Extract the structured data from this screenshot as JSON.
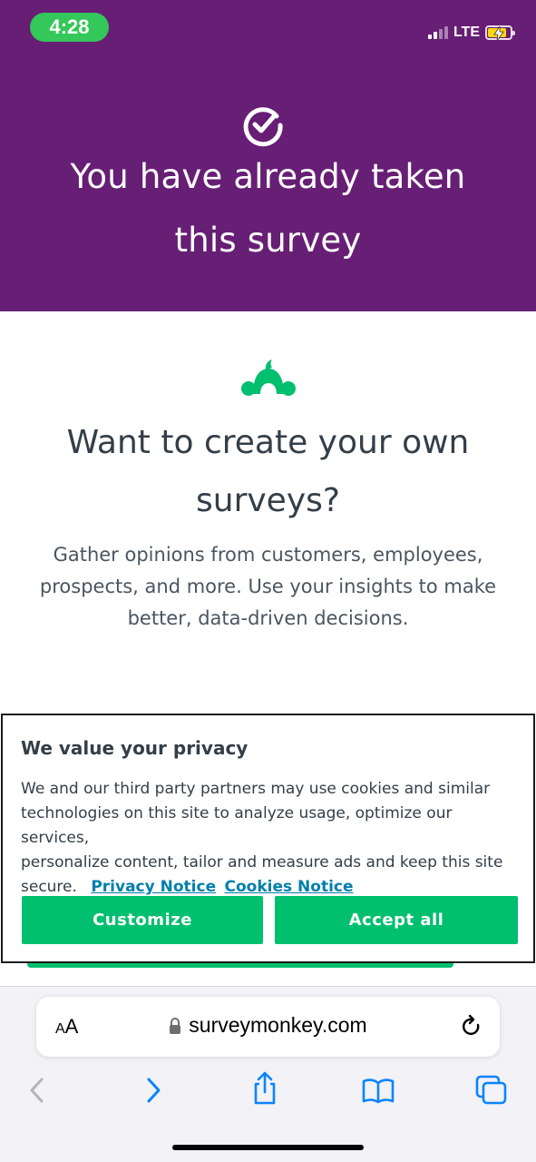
{
  "status_bar": {
    "time": "4:28",
    "network": "LTE"
  },
  "hero": {
    "title_line1": "You have already taken",
    "title_line2": "this survey"
  },
  "promo": {
    "title_line1": "Want to create your own",
    "title_line2": "surveys?",
    "text_line1": "Gather opinions from customers, employees,",
    "text_line2": "prospects, and more. Use your insights to make",
    "text_line3": "better, data-driven decisions."
  },
  "cookie_dialog": {
    "title": "We value your privacy",
    "text_line1": "We and our third party partners may use cookies and similar",
    "text_line2": "technologies on this site to analyze usage, optimize our services,",
    "text_line3": "personalize content, tailor and measure ads and keep this site",
    "text_line4": "secure.",
    "privacy_link": "Privacy Notice",
    "cookies_link": "Cookies Notice",
    "customize_label": "Customize",
    "accept_label": "Accept all"
  },
  "browser": {
    "text_size_label": "AA",
    "url": "surveymonkey.com"
  },
  "colors": {
    "hero_bg": "#671e75",
    "brand_green": "#00bf6f",
    "link": "#007faa",
    "text": "#333e48"
  },
  "icons": [
    "check-circle-icon",
    "surveymonkey-logo-icon",
    "lock-icon",
    "reload-icon",
    "back-icon",
    "forward-icon",
    "share-icon",
    "bookmarks-icon",
    "tabs-icon"
  ]
}
